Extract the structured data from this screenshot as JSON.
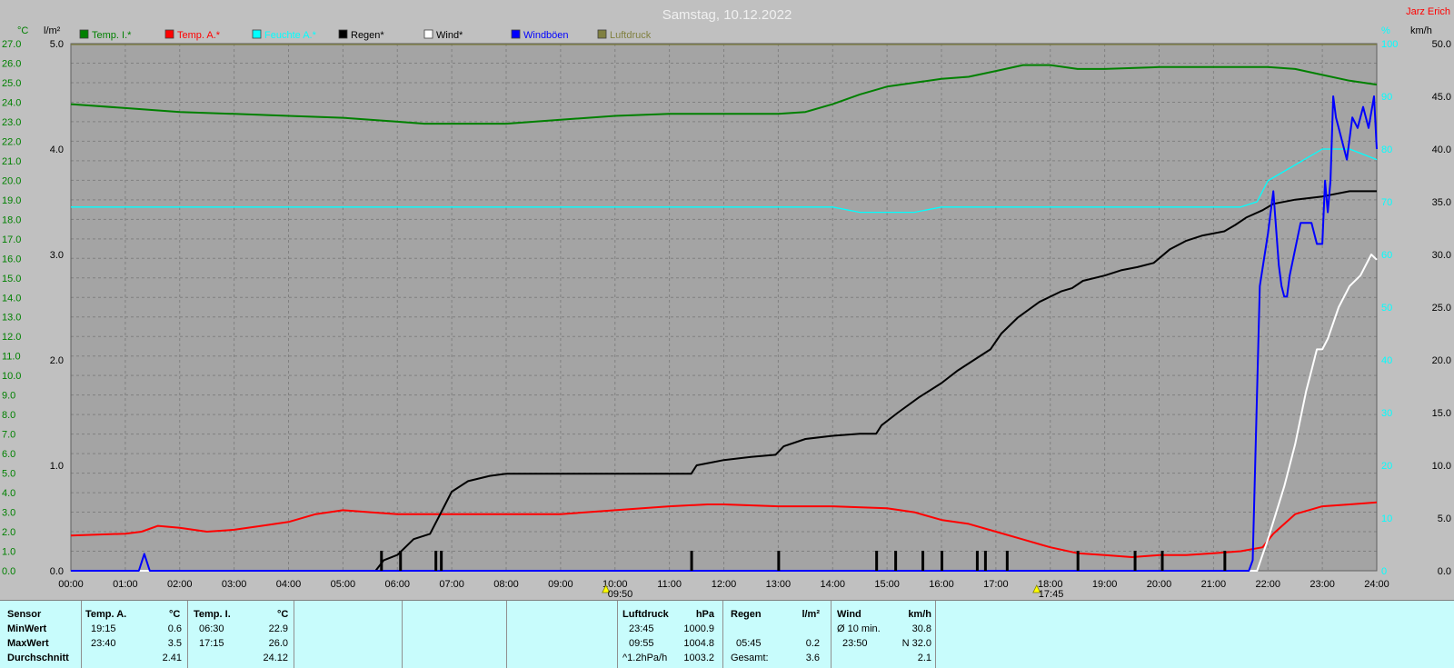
{
  "title": "Samstag, 10.12.2022",
  "author": "Jarz Erich",
  "legend": [
    {
      "label": "Temp. I.*",
      "color": "#008000"
    },
    {
      "label": "Temp. A.*",
      "color": "#ff0000"
    },
    {
      "label": "Feuchte A.*",
      "color": "#00ffff"
    },
    {
      "label": "Regen*",
      "color": "#000000"
    },
    {
      "label": "Wind*",
      "color": "#ffffff"
    },
    {
      "label": "Windböen",
      "color": "#0000ff"
    },
    {
      "label": "Luftdruck",
      "color": "#808040"
    }
  ],
  "axis_units": {
    "left_temp": "°C",
    "left_rain": "l/m²",
    "right_hum": "%",
    "right_wind": "km/h"
  },
  "markers": [
    {
      "label": "09:50"
    },
    {
      "label": "17:45"
    }
  ],
  "chart_data": {
    "type": "line",
    "title": "Samstag, 10.12.2022",
    "x_unit": "hours",
    "xlim": [
      0,
      24
    ],
    "x_ticks": [
      "00:00",
      "01:00",
      "02:00",
      "03:00",
      "04:00",
      "05:00",
      "06:00",
      "07:00",
      "08:00",
      "09:00",
      "10:00",
      "11:00",
      "12:00",
      "13:00",
      "14:00",
      "15:00",
      "16:00",
      "17:00",
      "18:00",
      "19:00",
      "20:00",
      "21:00",
      "22:00",
      "23:00",
      "24:00"
    ],
    "axes": {
      "temp": {
        "unit": "°C",
        "ylim": [
          0,
          27
        ],
        "ticks": [
          "0.0",
          "1.0",
          "2.0",
          "3.0",
          "4.0",
          "5.0",
          "6.0",
          "7.0",
          "8.0",
          "9.0",
          "10.0",
          "11.0",
          "12.0",
          "13.0",
          "14.0",
          "15.0",
          "16.0",
          "17.0",
          "18.0",
          "19.0",
          "20.0",
          "21.0",
          "22.0",
          "23.0",
          "24.0",
          "25.0",
          "26.0",
          "27.0"
        ]
      },
      "rain": {
        "unit": "l/m²",
        "ylim": [
          0,
          5
        ],
        "ticks": [
          "0.0",
          "1.0",
          "2.0",
          "3.0",
          "4.0",
          "5.0"
        ]
      },
      "hum": {
        "unit": "%",
        "ylim": [
          0,
          100
        ],
        "ticks": [
          "0",
          "10",
          "20",
          "30",
          "40",
          "50",
          "60",
          "70",
          "80",
          "90",
          "100"
        ]
      },
      "wind": {
        "unit": "km/h",
        "ylim": [
          0,
          50
        ],
        "ticks": [
          "0.0",
          "5.0",
          "10.0",
          "15.0",
          "20.0",
          "25.0",
          "30.0",
          "35.0",
          "40.0",
          "45.0",
          "50.0"
        ]
      }
    },
    "series": [
      {
        "name": "Temp. I.*",
        "axis": "temp",
        "color": "#008000",
        "x": [
          0,
          1,
          2,
          3,
          4,
          5,
          6,
          6.5,
          7,
          8,
          9,
          10,
          11,
          12,
          13,
          13.5,
          14,
          14.5,
          15,
          15.5,
          16,
          16.5,
          17,
          17.5,
          18,
          18.5,
          19,
          20,
          21,
          22,
          22.5,
          23,
          23.5,
          24
        ],
        "y": [
          23.9,
          23.7,
          23.5,
          23.4,
          23.3,
          23.2,
          23.0,
          22.9,
          22.9,
          22.9,
          23.1,
          23.3,
          23.4,
          23.4,
          23.4,
          23.5,
          23.9,
          24.4,
          24.8,
          25.0,
          25.2,
          25.3,
          25.6,
          25.9,
          25.9,
          25.7,
          25.7,
          25.8,
          25.8,
          25.8,
          25.7,
          25.4,
          25.1,
          24.9
        ]
      },
      {
        "name": "Temp. A.*",
        "axis": "temp",
        "color": "#ff0000",
        "x": [
          0,
          1,
          1.3,
          1.6,
          2,
          2.5,
          3,
          3.5,
          4,
          4.5,
          5,
          5.5,
          6,
          7,
          8,
          9,
          10,
          11,
          11.7,
          12,
          13,
          14,
          15,
          15.5,
          16,
          16.5,
          17,
          17.5,
          18,
          18.5,
          19,
          19.5,
          20,
          20.5,
          21,
          21.5,
          21.9,
          22.1,
          22.5,
          23,
          23.5,
          24
        ],
        "y": [
          1.8,
          1.9,
          2.0,
          2.3,
          2.2,
          2.0,
          2.1,
          2.3,
          2.5,
          2.9,
          3.1,
          3.0,
          2.9,
          2.9,
          2.9,
          2.9,
          3.1,
          3.3,
          3.4,
          3.4,
          3.3,
          3.3,
          3.2,
          3.0,
          2.6,
          2.4,
          2.0,
          1.6,
          1.2,
          0.9,
          0.8,
          0.7,
          0.8,
          0.8,
          0.9,
          1.0,
          1.2,
          1.9,
          2.9,
          3.3,
          3.4,
          3.5
        ]
      },
      {
        "name": "Feuchte A.*",
        "axis": "hum",
        "color": "#00ffff",
        "x": [
          0,
          3,
          6,
          9,
          12,
          13.5,
          14,
          14.5,
          15,
          15.5,
          16,
          17,
          18,
          20,
          21,
          21.5,
          21.8,
          22,
          22.5,
          23,
          23.5,
          24
        ],
        "y": [
          69,
          69,
          69,
          69,
          69,
          69,
          69,
          68,
          68,
          68,
          69,
          69,
          69,
          69,
          69,
          69,
          70,
          74,
          77,
          80,
          80,
          78
        ]
      },
      {
        "name": "Regen*",
        "axis": "rain",
        "color": "#000000",
        "x": [
          0,
          5.6,
          5.75,
          6,
          6.3,
          6.6,
          6.75,
          7,
          7.3,
          7.7,
          8,
          9,
          10,
          11,
          11.4,
          11.5,
          12,
          12.5,
          12.95,
          13.1,
          13.5,
          14,
          14.5,
          14.8,
          14.9,
          15.2,
          15.6,
          16,
          16.3,
          16.6,
          16.9,
          17.1,
          17.4,
          17.8,
          18.2,
          18.4,
          18.6,
          19,
          19.3,
          19.6,
          19.9,
          20.2,
          20.5,
          20.8,
          21.2,
          21.4,
          21.6,
          21.9,
          22.1,
          22.5,
          23,
          23.5,
          24
        ],
        "y": [
          0,
          0,
          0.1,
          0.15,
          0.3,
          0.35,
          0.5,
          0.75,
          0.85,
          0.9,
          0.92,
          0.92,
          0.92,
          0.92,
          0.92,
          1.0,
          1.05,
          1.08,
          1.1,
          1.18,
          1.25,
          1.28,
          1.3,
          1.3,
          1.38,
          1.5,
          1.65,
          1.78,
          1.9,
          2.0,
          2.1,
          2.25,
          2.4,
          2.55,
          2.65,
          2.68,
          2.75,
          2.8,
          2.85,
          2.88,
          2.92,
          3.05,
          3.13,
          3.18,
          3.22,
          3.28,
          3.35,
          3.42,
          3.48,
          3.52,
          3.55,
          3.6,
          3.6
        ]
      },
      {
        "name": "Wind*",
        "axis": "wind",
        "color": "#ffffff",
        "x": [
          0,
          21.8,
          22.0,
          22.3,
          22.5,
          22.7,
          22.8,
          22.9,
          23.0,
          23.1,
          23.3,
          23.5,
          23.7,
          23.9,
          24
        ],
        "y": [
          0,
          0,
          3,
          8,
          12,
          17,
          19,
          21,
          21,
          22,
          25,
          27,
          28,
          30,
          29.5
        ]
      },
      {
        "name": "Windböen",
        "axis": "wind",
        "color": "#0000ff",
        "x": [
          0,
          1.25,
          1.35,
          1.45,
          21.65,
          21.72,
          21.85,
          22.0,
          22.1,
          22.2,
          22.25,
          22.3,
          22.35,
          22.4,
          22.6,
          22.8,
          22.9,
          23.0,
          23.05,
          23.1,
          23.15,
          23.2,
          23.25,
          23.35,
          23.45,
          23.55,
          23.65,
          23.75,
          23.85,
          23.95,
          24
        ],
        "y": [
          0,
          0,
          1.6,
          0,
          0,
          1,
          27,
          32,
          36,
          29,
          27,
          26,
          26,
          28,
          33,
          33,
          31,
          31,
          37,
          34,
          37,
          45,
          43,
          41,
          39,
          43,
          42,
          44,
          42,
          45,
          40
        ]
      },
      {
        "name": "Luftdruck",
        "axis": "pressure",
        "color": "#808040",
        "x": [
          0,
          24
        ],
        "y": [
          1003.2,
          1003.2
        ]
      }
    ],
    "rain_events": [
      5.7,
      6.05,
      6.7,
      6.8,
      11.4,
      13.0,
      14.8,
      15.15,
      15.65,
      16.0,
      16.65,
      16.8,
      17.2,
      18.5,
      19.55,
      20.05,
      21.2
    ]
  },
  "stats": {
    "temp_a": {
      "header": "Temp. A.",
      "unit": "°C",
      "min_time": "19:15",
      "min_val": "0.6",
      "max_time": "23:40",
      "max_val": "3.5",
      "avg": "2.41"
    },
    "temp_i": {
      "header": "Temp. I.",
      "unit": "°C",
      "min_time": "06:30",
      "min_val": "22.9",
      "max_time": "17:15",
      "max_val": "26.0",
      "avg": "24.12"
    },
    "labels": {
      "sensor": "Sensor",
      "min": "MinWert",
      "max": "MaxWert",
      "avg": "Durchschnitt"
    },
    "pressure": {
      "header": "Luftdruck",
      "unit": "hPa",
      "r1_left": "23:45",
      "r1_val": "1000.9",
      "r2_left": "09:55",
      "r2_val": "1004.8",
      "r3_left": "^1.2hPa/h",
      "r3_val": "1003.2"
    },
    "rain": {
      "header": "Regen",
      "unit": "l/m²",
      "r2_left": "05:45",
      "r2_val": "0.2",
      "r3_left": "Gesamt:",
      "r3_val": "3.6"
    },
    "wind": {
      "header": "Wind",
      "unit": "km/h",
      "r1_left": "Ø 10 min.",
      "r1_val": "30.8",
      "r2_left": "23:50",
      "r2_val": "N 32.0",
      "r3_val": "2.1"
    }
  }
}
